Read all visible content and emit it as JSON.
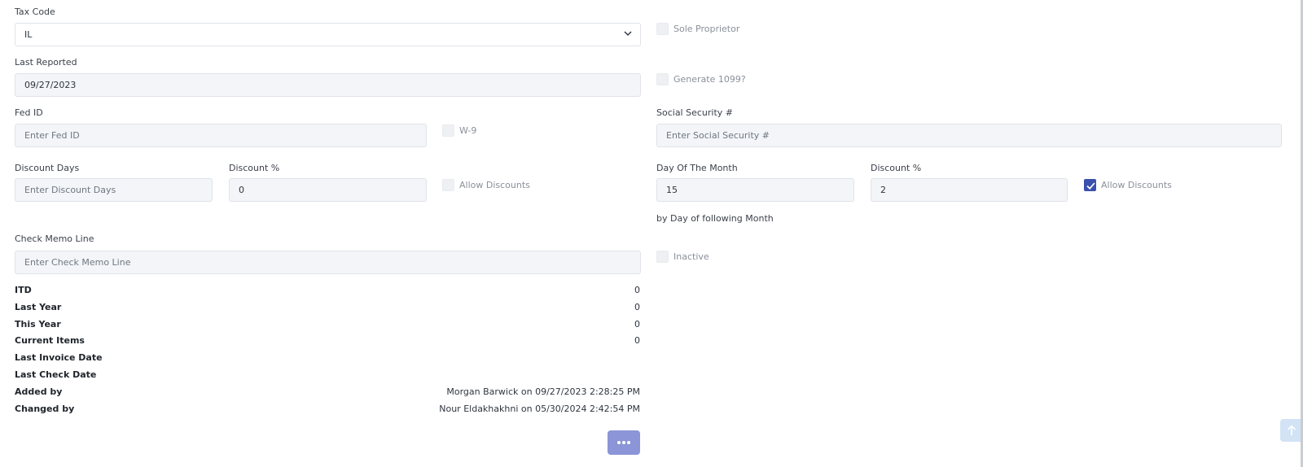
{
  "left": {
    "tax_code": {
      "label": "Tax Code",
      "value": "IL"
    },
    "last_reported": {
      "label": "Last Reported",
      "value": "09/27/2023"
    },
    "fed_id": {
      "label": "Fed ID",
      "placeholder": "Enter Fed ID"
    },
    "w9": {
      "label": "W-9"
    },
    "discount_days": {
      "label": "Discount Days",
      "placeholder": "Enter Discount Days"
    },
    "discount_pct": {
      "label": "Discount %",
      "value": "0"
    },
    "allow_discounts": {
      "label": "Allow Discounts"
    },
    "check_memo": {
      "label": "Check Memo Line",
      "placeholder": "Enter Check Memo Line"
    }
  },
  "right": {
    "sole_proprietor": {
      "label": "Sole Proprietor"
    },
    "generate_1099": {
      "label": "Generate 1099?"
    },
    "social_security": {
      "label": "Social Security #",
      "placeholder": "Enter Social Security #"
    },
    "day_of_month": {
      "label": "Day Of The Month",
      "value": "15"
    },
    "discount_pct": {
      "label": "Discount %",
      "value": "2"
    },
    "allow_discounts": {
      "label": "Allow Discounts",
      "checked": true
    },
    "by_day_note": "by Day of following Month",
    "inactive": {
      "label": "Inactive"
    }
  },
  "stats": [
    {
      "label": "ITD",
      "value": "0"
    },
    {
      "label": "Last Year",
      "value": "0"
    },
    {
      "label": "This Year",
      "value": "0"
    },
    {
      "label": "Current Items",
      "value": "0"
    },
    {
      "label": "Last Invoice Date",
      "value": ""
    },
    {
      "label": "Last Check Date",
      "value": ""
    },
    {
      "label": "Added by",
      "value": "Morgan Barwick on 09/27/2023 2:28:25 PM"
    },
    {
      "label": "Changed by",
      "value": "Nour Eldakhakhni on 05/30/2024 2:42:54 PM"
    }
  ],
  "icons": {
    "more": "ellipsis-icon",
    "scroll_top": "arrow-up-icon",
    "dropdown": "chevron-down-icon"
  },
  "colors": {
    "accent": "#3a4fae",
    "more_button": "#8b95d8",
    "field_bg": "#f3f5f8"
  }
}
